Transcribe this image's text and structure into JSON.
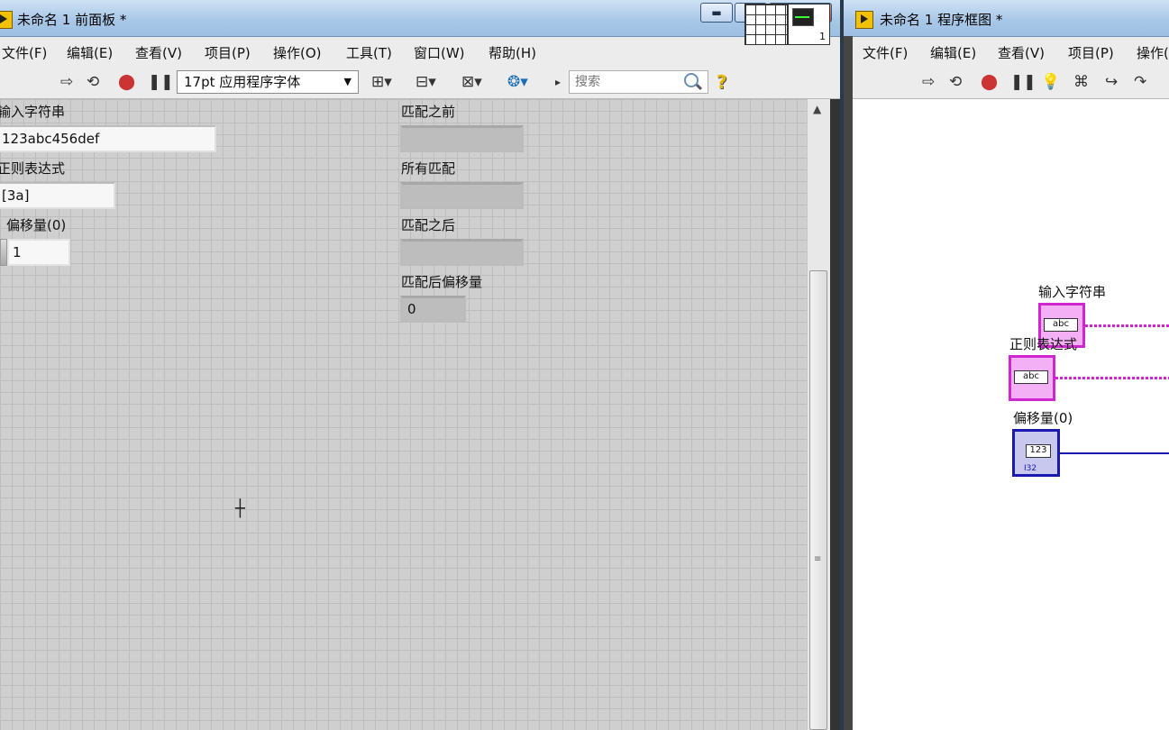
{
  "front_panel": {
    "title": "未命名 1 前面板 *",
    "menu": [
      "文件(F)",
      "编辑(E)",
      "查看(V)",
      "项目(P)",
      "操作(O)",
      "工具(T)",
      "窗口(W)",
      "帮助(H)"
    ],
    "toolbar": {
      "font": "17pt 应用程序字体",
      "search_placeholder": "搜索",
      "vi_icon_number": "1"
    },
    "controls": {
      "input_string_label": "输入字符串",
      "input_string_value": "123abc456def",
      "regex_label": "正则表达式",
      "regex_value": "[3a]",
      "offset_label": "偏移量(0)",
      "offset_value": "1"
    },
    "indicators": {
      "before_label": "匹配之前",
      "before_value": "",
      "whole_label": "所有匹配",
      "whole_value": "",
      "after_label": "匹配之后",
      "after_value": "",
      "offset_after_label": "匹配后偏移量",
      "offset_after_value": "0"
    }
  },
  "block_diagram": {
    "title": "未命名 1 程序框图 *",
    "menu": [
      "文件(F)",
      "编辑(E)",
      "查看(V)",
      "项目(P)",
      "操作("
    ],
    "terminals": {
      "input_string_label": "输入字符串",
      "input_string_glyph": "abc",
      "regex_label": "正则表达式",
      "regex_glyph": "abc",
      "offset_label": "偏移量(0)",
      "offset_glyph": "123",
      "offset_type": "I32"
    }
  }
}
